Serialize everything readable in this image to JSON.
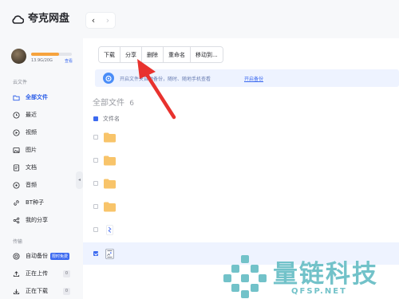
{
  "app": {
    "title": "夸克网盘"
  },
  "nav": {
    "back": "‹",
    "forward": "›"
  },
  "sidebar": {
    "quota_text": "13.9G/20G",
    "quota_fraction": 0.695,
    "quota_link": "查看",
    "section_cloud": "云文件",
    "items": [
      {
        "label": "全部文件",
        "icon": "folder-outline-icon",
        "active": true
      },
      {
        "label": "最近",
        "icon": "clock-icon"
      },
      {
        "label": "视频",
        "icon": "video-icon"
      },
      {
        "label": "图片",
        "icon": "image-icon"
      },
      {
        "label": "文档",
        "icon": "document-icon"
      },
      {
        "label": "音频",
        "icon": "audio-icon"
      },
      {
        "label": "BT种子",
        "icon": "link-icon"
      },
      {
        "label": "我的分享",
        "icon": "share-icon"
      }
    ],
    "section_transfer": "传输",
    "transfer": [
      {
        "label": "自动备份",
        "badge": "限时免费",
        "icon": "backup-icon"
      },
      {
        "label": "正在上传",
        "count": "0",
        "icon": "upload-icon"
      },
      {
        "label": "正在下载",
        "count": "0",
        "icon": "download-icon"
      }
    ],
    "collapse": "◂"
  },
  "toolbar": {
    "download": "下载",
    "share": "分享",
    "delete": "删除",
    "rename": "重命名",
    "move": "移动到..."
  },
  "banner": {
    "text": "开启文件夹自动备份，随时、随地手机查看",
    "link": "开启备份"
  },
  "breadcrumb": {
    "title": "全部文件",
    "count": "6"
  },
  "list": {
    "column_name": "文件名",
    "rows": [
      {
        "type": "folder",
        "selected": false
      },
      {
        "type": "folder",
        "selected": false
      },
      {
        "type": "folder",
        "selected": false
      },
      {
        "type": "folder",
        "selected": false
      },
      {
        "type": "file-blue",
        "selected": false
      },
      {
        "type": "file-image",
        "selected": true
      }
    ]
  },
  "watermark": {
    "main": "量链科技",
    "sub": "QFSP.NET"
  },
  "colors": {
    "accent": "#3c6af0",
    "folder": "#f8c46a",
    "arrow": "#e8322e",
    "quota": "#f6a33d"
  }
}
